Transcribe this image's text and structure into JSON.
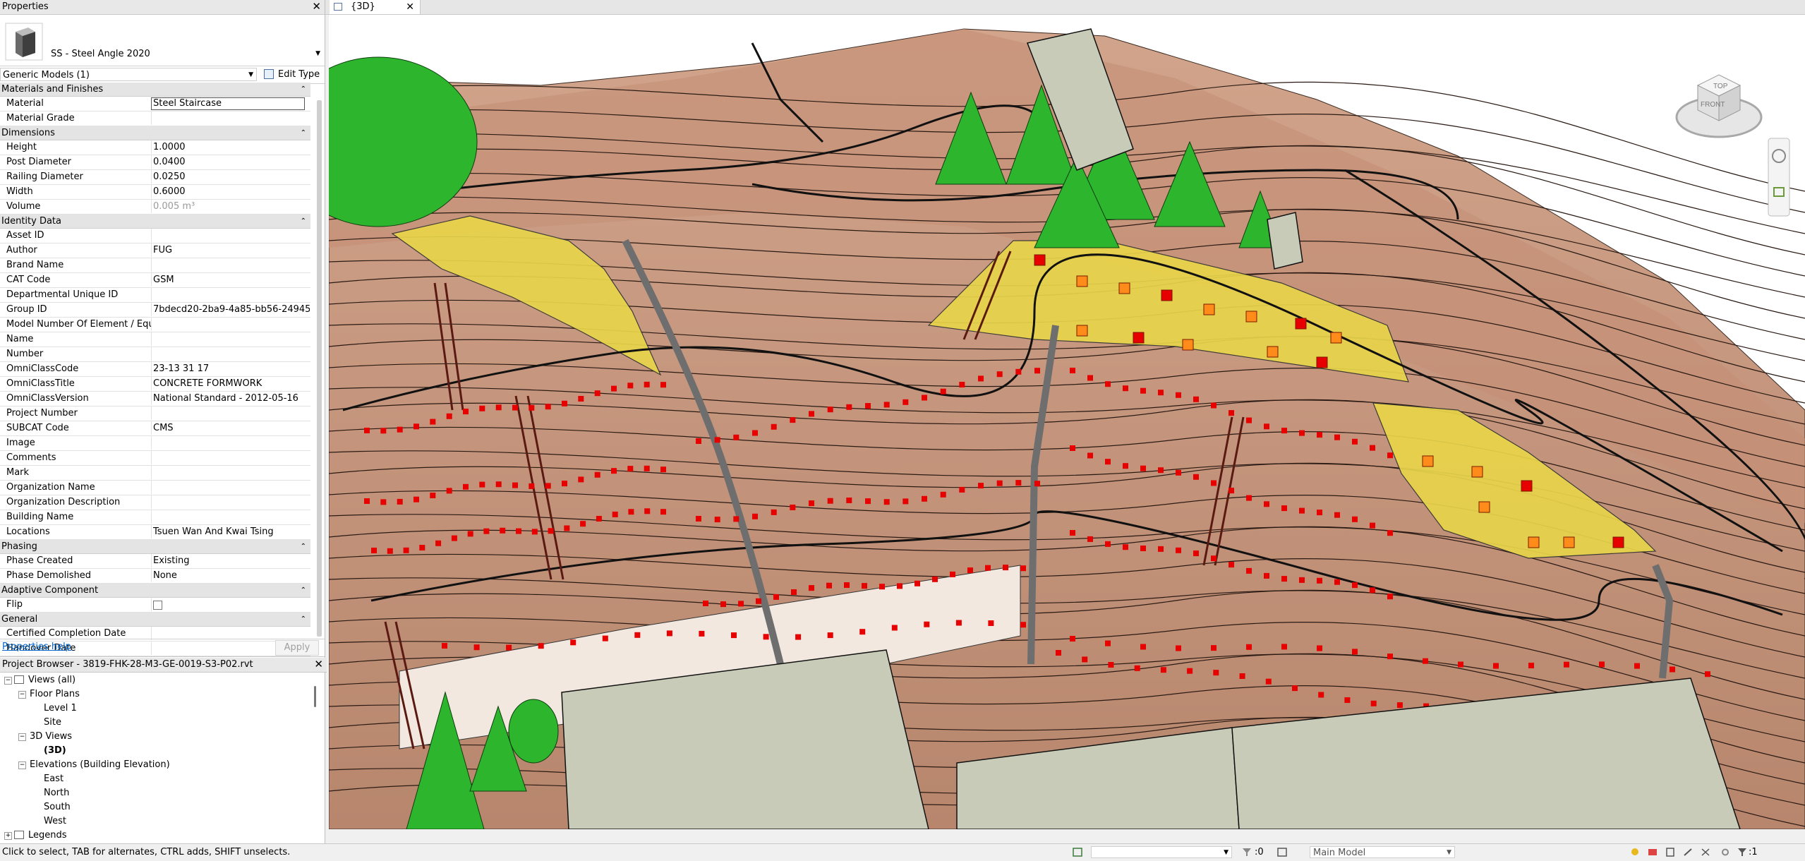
{
  "properties_panel": {
    "title": "Properties",
    "type_name": "SS - Steel Angle 2020",
    "filter_value": "Generic Models (1)",
    "edit_type_label": "Edit Type",
    "groups": [
      {
        "name": "Materials and Finishes",
        "rows": [
          {
            "name": "Material",
            "value": "Steel Staircase"
          },
          {
            "name": "Material Grade",
            "value": ""
          }
        ]
      },
      {
        "name": "Dimensions",
        "rows": [
          {
            "name": "Height",
            "value": "1.0000"
          },
          {
            "name": "Post Diameter",
            "value": "0.0400"
          },
          {
            "name": "Railing Diameter",
            "value": "0.0250"
          },
          {
            "name": "Width",
            "value": "0.6000"
          },
          {
            "name": "Volume",
            "value": "0.005 m³"
          }
        ]
      },
      {
        "name": "Identity Data",
        "rows": [
          {
            "name": "Asset ID",
            "value": ""
          },
          {
            "name": "Author",
            "value": "FUG"
          },
          {
            "name": "Brand Name",
            "value": ""
          },
          {
            "name": "CAT Code",
            "value": "GSM"
          },
          {
            "name": "Departmental Unique ID",
            "value": ""
          },
          {
            "name": "Group ID",
            "value": "7bdecd20-2ba9-4a85-bb56-24945..."
          },
          {
            "name": "Model Number Of Element / Equ...",
            "value": ""
          },
          {
            "name": "Name",
            "value": ""
          },
          {
            "name": "Number",
            "value": ""
          },
          {
            "name": "OmniClassCode",
            "value": "23-13 31 17"
          },
          {
            "name": "OmniClassTitle",
            "value": "CONCRETE FORMWORK"
          },
          {
            "name": "OmniClassVersion",
            "value": "National Standard - 2012-05-16"
          },
          {
            "name": "Project Number",
            "value": ""
          },
          {
            "name": "SUBCAT Code",
            "value": "CMS"
          },
          {
            "name": "Image",
            "value": ""
          },
          {
            "name": "Comments",
            "value": ""
          },
          {
            "name": "Mark",
            "value": ""
          },
          {
            "name": "Organization Name",
            "value": ""
          },
          {
            "name": "Organization Description",
            "value": ""
          },
          {
            "name": "Building Name",
            "value": ""
          },
          {
            "name": "Locations",
            "value": "Tsuen Wan And Kwai Tsing"
          }
        ]
      },
      {
        "name": "Phasing",
        "rows": [
          {
            "name": "Phase Created",
            "value": "Existing"
          },
          {
            "name": "Phase Demolished",
            "value": "None"
          }
        ]
      },
      {
        "name": "Adaptive Component",
        "rows": [
          {
            "name": "Flip",
            "value": ""
          }
        ]
      },
      {
        "name": "General",
        "rows": [
          {
            "name": "Certified Completion Date",
            "value": ""
          },
          {
            "name": "Handover Date",
            "value": ""
          }
        ]
      }
    ],
    "help_link": "Properties help",
    "apply_label": "Apply"
  },
  "project_browser": {
    "title": "Project Browser - 3819-FHK-28-M3-GE-0019-S3-P02.rvt",
    "tree": [
      {
        "label": "Views (all)",
        "level": 0,
        "toggle": "−",
        "icon": "views"
      },
      {
        "label": "Floor Plans",
        "level": 1,
        "toggle": "−"
      },
      {
        "label": "Level 1",
        "level": 2
      },
      {
        "label": "Site",
        "level": 2
      },
      {
        "label": "3D Views",
        "level": 1,
        "toggle": "−"
      },
      {
        "label": "(3D)",
        "level": 2,
        "bold": true
      },
      {
        "label": "Elevations (Building Elevation)",
        "level": 1,
        "toggle": "−"
      },
      {
        "label": "East",
        "level": 2
      },
      {
        "label": "North",
        "level": 2
      },
      {
        "label": "South",
        "level": 2
      },
      {
        "label": "West",
        "level": 2
      },
      {
        "label": "Legends",
        "level": 0,
        "toggle": "+",
        "icon": "legend"
      }
    ]
  },
  "view_tab": {
    "label": "{3D}"
  },
  "viewcube": {
    "top_label": "TOP",
    "front_label": "FRONT"
  },
  "status_bar": {
    "hint": "Click to select, TAB for alternates, CTRL adds, SHIFT unselects.",
    "selection_count": ":0",
    "model_combo": "Main Model",
    "filter_count": ":1"
  },
  "colors": {
    "terrain": "#c99a80",
    "terrain_dark": "#9a6f5c",
    "formwork_yellow": "#e8d44a",
    "marker_red": "#e60000",
    "marker_orange": "#ff8c1a",
    "tree_green": "#2db52d",
    "building": "#c8cbb8"
  }
}
